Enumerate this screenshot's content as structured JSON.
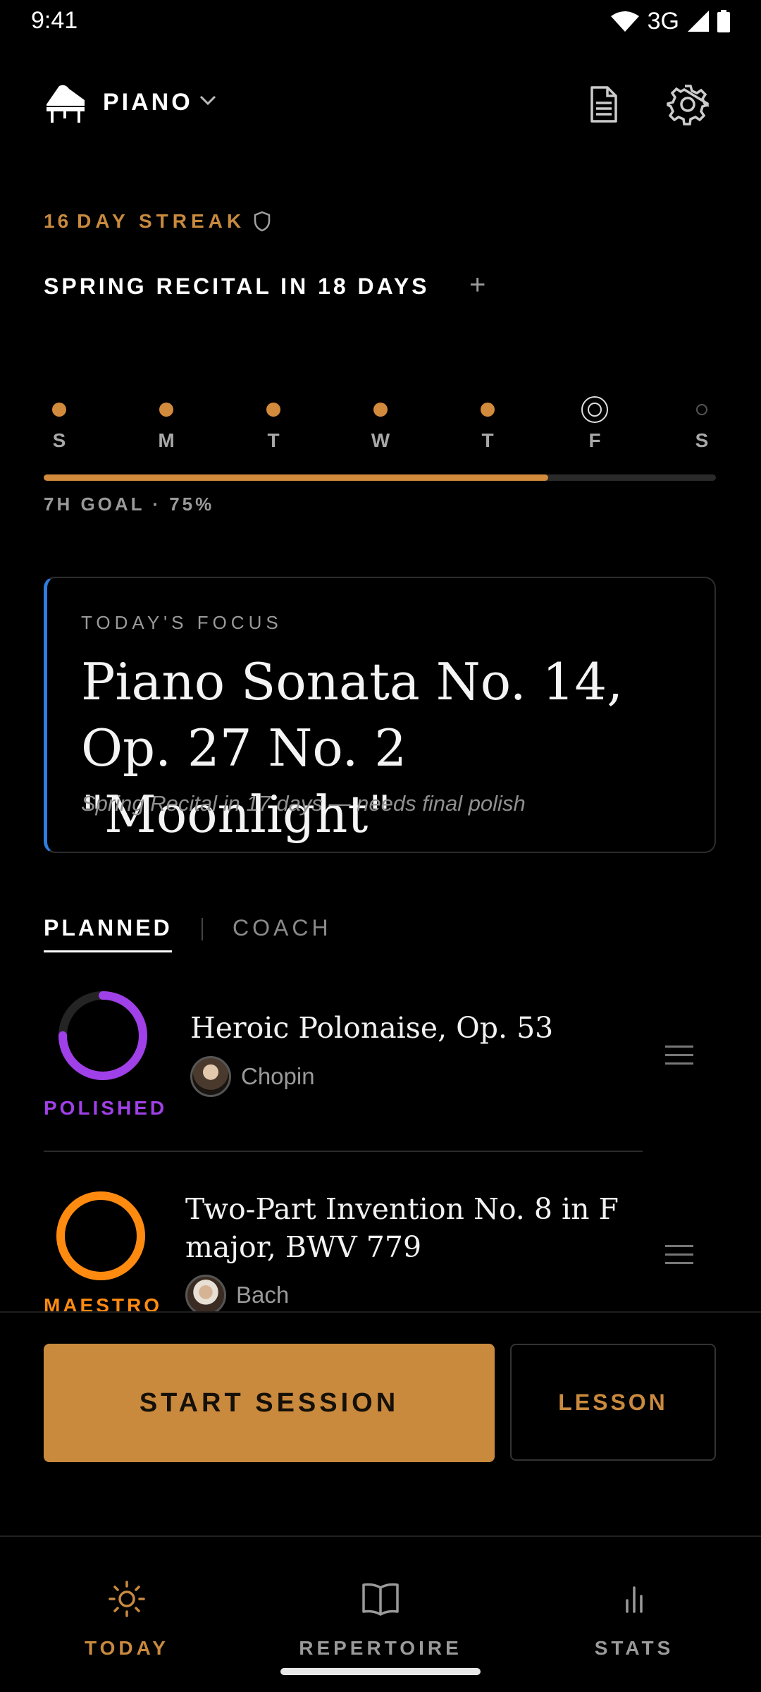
{
  "status_bar": {
    "time": "9:41",
    "network": "3G"
  },
  "header": {
    "instrument": "PIANO",
    "icons": [
      "grand-piano-icon",
      "chevron-down-icon",
      "document-icon",
      "gear-icon"
    ]
  },
  "streak": {
    "count": "16",
    "label": "DAY STREAK"
  },
  "recital": {
    "label": "SPRING RECITAL IN 18 DAYS",
    "add": "+"
  },
  "week": {
    "days": [
      "S",
      "M",
      "T",
      "W",
      "T",
      "F",
      "S"
    ],
    "states": [
      "done",
      "done",
      "done",
      "done",
      "done",
      "today",
      "upcoming"
    ],
    "goal_label": "7H GOAL · 75%",
    "progress": 0.75
  },
  "focus": {
    "kicker": "TODAY'S FOCUS",
    "title": "Piano Sonata No. 14, Op. 27 No. 2 \"Moonlight\"",
    "subtitle": "Spring Recital in 17 days — needs final polish"
  },
  "tabs": {
    "planned": "PLANNED",
    "coach": "COACH",
    "active": "planned"
  },
  "pieces": [
    {
      "title": "Heroic Polonaise, Op. 53",
      "composer": "Chopin",
      "status": "POLISHED",
      "status_color": "#a040e8",
      "progress": 0.75
    },
    {
      "title": "Two-Part Invention No. 8 in F major, BWV 779",
      "composer": "Bach",
      "status": "MAESTRO",
      "status_color": "#ff8a10",
      "progress": 1.0
    }
  ],
  "actions": {
    "start": "START SESSION",
    "lesson": "LESSON"
  },
  "nav": [
    {
      "label": "TODAY",
      "icon": "sun-icon",
      "active": true
    },
    {
      "label": "REPERTOIRE",
      "icon": "book-icon",
      "active": false
    },
    {
      "label": "STATS",
      "icon": "bar-chart-icon",
      "active": false
    }
  ],
  "colors": {
    "accent": "#c98a3e",
    "focus_bar": "#2f7de0",
    "background": "#000000"
  }
}
